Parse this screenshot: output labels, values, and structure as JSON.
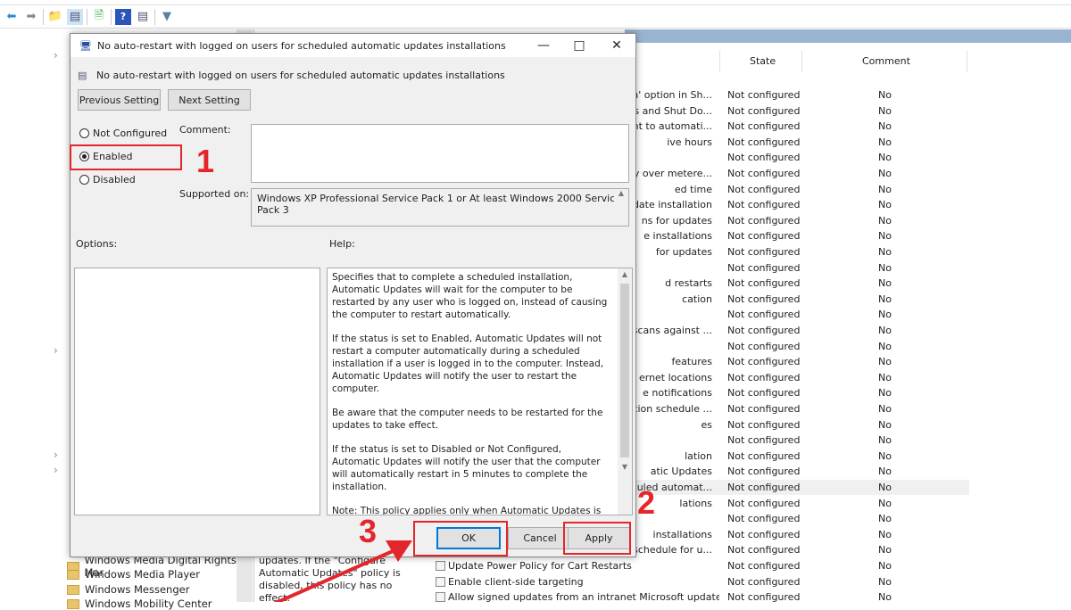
{
  "toolbar": {
    "icons": [
      "back-arrow-icon",
      "forward-arrow-icon",
      "up-folder-icon",
      "show-hide-tree-icon",
      "export-list-icon",
      "help-icon",
      "properties-icon",
      "filter-icon"
    ]
  },
  "tree": {
    "items": [
      "Windows Media Digital Rights Mar",
      "Windows Media Player",
      "Windows Messenger",
      "Windows Mobility Center"
    ]
  },
  "middle": {
    "description": "updates. If the \"Configure Automatic Updates\" policy is disabled, this policy has no effect."
  },
  "list": {
    "columns": {
      "state": "State",
      "comment": "Comment"
    },
    "rows": [
      {
        "name": "wn' option in Sh...",
        "state": "Not configured",
        "comment": "No"
      },
      {
        "name": "ates and Shut Do...",
        "state": "Not configured",
        "comment": "No"
      },
      {
        "name": "ment to automati...",
        "state": "Not configured",
        "comment": "No"
      },
      {
        "name": "ive hours",
        "state": "Not configured",
        "comment": "No"
      },
      {
        "name": "",
        "state": "Not configured",
        "comment": "No"
      },
      {
        "name": "cally over metere...",
        "state": "Not configured",
        "comment": "No"
      },
      {
        "name": "ed time",
        "state": "Not configured",
        "comment": "No"
      },
      {
        "name": "date installation",
        "state": "Not configured",
        "comment": "No"
      },
      {
        "name": "ns for updates",
        "state": "Not configured",
        "comment": "No"
      },
      {
        "name": "e installations",
        "state": "Not configured",
        "comment": "No"
      },
      {
        "name": "for updates",
        "state": "Not configured",
        "comment": "No"
      },
      {
        "name": "",
        "state": "Not configured",
        "comment": "No"
      },
      {
        "name": "d restarts",
        "state": "Not configured",
        "comment": "No"
      },
      {
        "name": "cation",
        "state": "Not configured",
        "comment": "No"
      },
      {
        "name": "",
        "state": "Not configured",
        "comment": "No"
      },
      {
        "name": "se scans against ...",
        "state": "Not configured",
        "comment": "No"
      },
      {
        "name": "",
        "state": "Not configured",
        "comment": "No"
      },
      {
        "name": "features",
        "state": "Not configured",
        "comment": "No"
      },
      {
        "name": "ernet locations",
        "state": "Not configured",
        "comment": "No"
      },
      {
        "name": "e notifications",
        "state": "Not configured",
        "comment": "No"
      },
      {
        "name": "ication schedule ...",
        "state": "Not configured",
        "comment": "No"
      },
      {
        "name": "es",
        "state": "Not configured",
        "comment": "No"
      },
      {
        "name": "",
        "state": "Not configured",
        "comment": "No"
      },
      {
        "name": "lation",
        "state": "Not configured",
        "comment": "No"
      },
      {
        "name": "atic Updates",
        "state": "Not configured",
        "comment": "No"
      },
      {
        "name": "heduled automat...",
        "state": "Not configured",
        "comment": "No",
        "selected": true
      },
      {
        "name": "lations",
        "state": "Not configured",
        "comment": "No"
      },
      {
        "name": "",
        "state": "Not configured",
        "comment": "No"
      },
      {
        "name": "installations",
        "state": "Not configured",
        "comment": "No"
      },
      {
        "name": "s schedule for u...",
        "state": "Not configured",
        "comment": "No"
      },
      {
        "name": "Update Power Policy for Cart Restarts",
        "state": "Not configured",
        "comment": "No",
        "full": true
      },
      {
        "name": "Enable client-side targeting",
        "state": "Not configured",
        "comment": "No",
        "full": true
      },
      {
        "name": "Allow signed updates from an intranet Microsoft update ser...",
        "state": "Not configured",
        "comment": "No",
        "full": true
      }
    ]
  },
  "dialog": {
    "title": "No auto-restart with logged on users for scheduled automatic updates installations",
    "setting_name": "No auto-restart with logged on users for scheduled automatic updates installations",
    "previous_setting": "Previous Setting",
    "next_setting": "Next Setting",
    "radio": {
      "not_configured": "Not Configured",
      "enabled": "Enabled",
      "disabled": "Disabled",
      "selected": "Enabled"
    },
    "comment_label": "Comment:",
    "comment_value": "",
    "supported_label": "Supported on:",
    "supported_value": "Windows XP Professional Service Pack 1 or At least Windows 2000 Service Pack 3",
    "options_label": "Options:",
    "help_label": "Help:",
    "help": [
      "Specifies that to complete a scheduled installation, Automatic Updates will wait for the computer to be restarted by any user who is logged on, instead of causing the computer to restart automatically.",
      "If the status is set to Enabled, Automatic Updates will not restart a computer automatically during a scheduled installation if a user is logged in to the computer. Instead, Automatic Updates will notify the user to restart the computer.",
      "Be aware that the computer needs to be restarted for the updates to take effect.",
      "If the status is set to Disabled or Not Configured, Automatic Updates will notify the user that the computer will automatically restart in 5 minutes to complete the installation.",
      "Note: This policy applies only when Automatic Updates is configured to perform scheduled installations of updates. If the \"Configure Automatic Updates\" policy is disabled, this policy has no effect."
    ],
    "ok": "OK",
    "cancel": "Cancel",
    "apply": "Apply"
  },
  "annotations": {
    "step1": "1",
    "step2": "2",
    "step3": "3",
    "color": "#e3262b"
  }
}
